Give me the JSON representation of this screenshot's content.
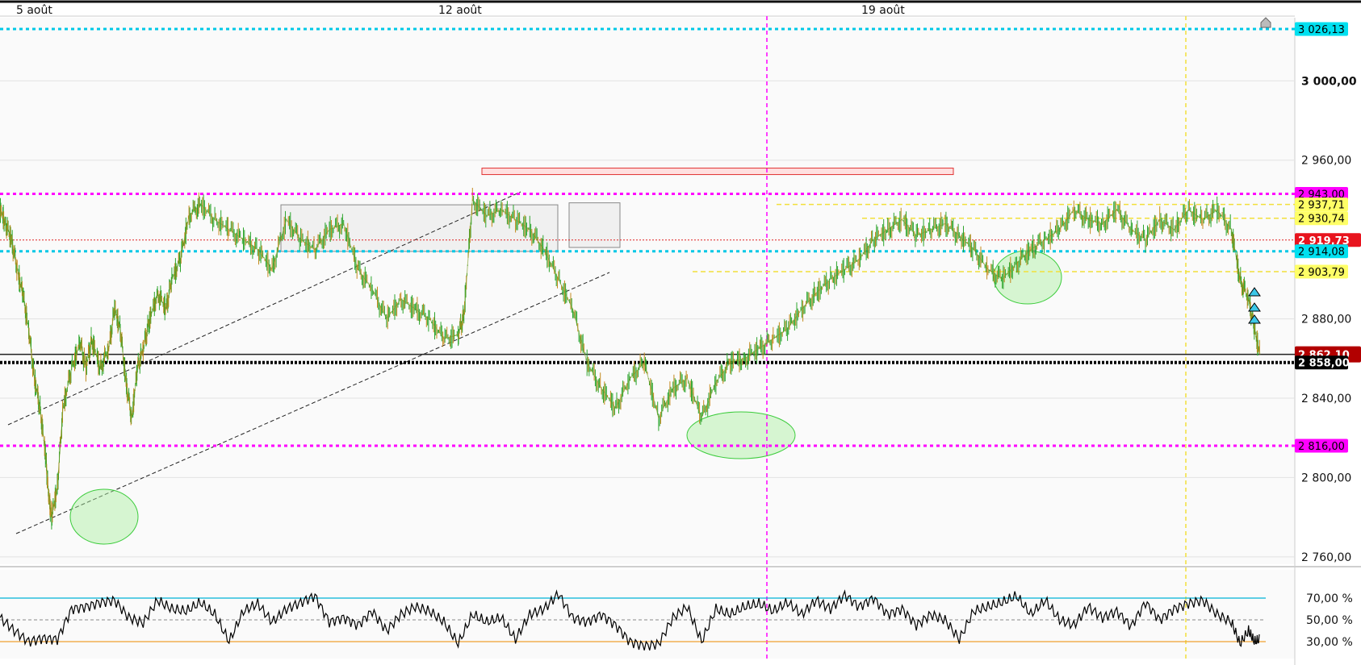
{
  "chart_data": {
    "type": "line",
    "instrument_panel": "price",
    "dates": [
      "5 août",
      "12 août",
      "19 août"
    ],
    "price_axis": {
      "ylim": [
        2752,
        2936.5
      ],
      "ticks": [
        {
          "value": 3000,
          "label": "3 000,00",
          "bold": true
        },
        {
          "value": 2960,
          "label": "2 960,00"
        },
        {
          "value": 2880,
          "label": "2 880,00"
        },
        {
          "value": 2840,
          "label": "2 840,00"
        },
        {
          "value": 2800,
          "label": "2 800,00"
        },
        {
          "value": 2760,
          "label": "2 760,00"
        }
      ]
    },
    "levels": [
      {
        "value": 3026.13,
        "label": "3 026,13",
        "style": "dotted",
        "color": "#00c8e6",
        "tag_bg": "#00e0f0",
        "tag_fg": "#000"
      },
      {
        "value": 2943.0,
        "label": "2 943,00",
        "style": "dotted",
        "color": "#ff00ff",
        "tag_bg": "#ff00ff",
        "tag_fg": "#000"
      },
      {
        "value": 2937.71,
        "label": "2 937,71",
        "style": "dashed",
        "color": "#f2e03a",
        "tag_bg": "#ffff66",
        "tag_fg": "#000"
      },
      {
        "value": 2930.74,
        "label": "2 930,74",
        "style": "dashed",
        "color": "#f2e03a",
        "tag_bg": "#ffff66",
        "tag_fg": "#000"
      },
      {
        "value": 2919.73,
        "label": "2 919,73",
        "style": "thin-dotted",
        "color": "#e02020",
        "tag_bg": "#e8141e",
        "tag_fg": "#fff"
      },
      {
        "value": 2914.08,
        "label": "2 914,08",
        "style": "dotted",
        "color": "#00c8e6",
        "tag_bg": "#00e0f0",
        "tag_fg": "#000"
      },
      {
        "value": 2903.79,
        "label": "2 903,79",
        "style": "dashed",
        "color": "#f2e03a",
        "tag_bg": "#ffff66",
        "tag_fg": "#000"
      },
      {
        "value": 2862.1,
        "label": "2 862,10",
        "style": "solid",
        "color": "#222",
        "tag_bg": "#b20000",
        "tag_fg": "#fff"
      },
      {
        "value": 2858.0,
        "label": "2 858,00",
        "style": "thick-dotted",
        "color": "#000",
        "tag_bg": "#000",
        "tag_fg": "#fff"
      },
      {
        "value": 2816.0,
        "label": "2 816,00",
        "style": "dotted",
        "color": "#ff00ff",
        "tag_bg": "#ff00ff",
        "tag_fg": "#000"
      }
    ],
    "price_series": [
      [
        0,
        2935
      ],
      [
        0.02,
        2928
      ],
      [
        0.04,
        2920
      ],
      [
        0.06,
        2905
      ],
      [
        0.08,
        2892
      ],
      [
        0.1,
        2875
      ],
      [
        0.12,
        2850
      ],
      [
        0.14,
        2835
      ],
      [
        0.16,
        2810
      ],
      [
        0.17,
        2790
      ],
      [
        0.18,
        2780
      ],
      [
        0.2,
        2795
      ],
      [
        0.22,
        2835
      ],
      [
        0.25,
        2855
      ],
      [
        0.28,
        2868
      ],
      [
        0.3,
        2855
      ],
      [
        0.32,
        2870
      ],
      [
        0.35,
        2855
      ],
      [
        0.38,
        2865
      ],
      [
        0.4,
        2885
      ],
      [
        0.42,
        2875
      ],
      [
        0.44,
        2848
      ],
      [
        0.46,
        2830
      ],
      [
        0.48,
        2855
      ],
      [
        0.5,
        2865
      ],
      [
        0.52,
        2878
      ],
      [
        0.55,
        2893
      ],
      [
        0.58,
        2885
      ],
      [
        0.6,
        2900
      ],
      [
        0.63,
        2910
      ],
      [
        0.66,
        2932
      ],
      [
        0.7,
        2938
      ],
      [
        0.75,
        2930
      ],
      [
        0.8,
        2925
      ],
      [
        0.85,
        2920
      ],
      [
        0.9,
        2915
      ],
      [
        0.95,
        2905
      ],
      [
        1.0,
        2930
      ],
      [
        1.05,
        2920
      ],
      [
        1.1,
        2915
      ],
      [
        1.15,
        2925
      ],
      [
        1.2,
        2928
      ],
      [
        1.25,
        2905
      ],
      [
        1.3,
        2895
      ],
      [
        1.35,
        2880
      ],
      [
        1.4,
        2890
      ],
      [
        1.45,
        2885
      ],
      [
        1.5,
        2880
      ],
      [
        1.55,
        2870
      ],
      [
        1.6,
        2872
      ],
      [
        1.62,
        2882
      ],
      [
        1.65,
        2940
      ],
      [
        1.7,
        2932
      ],
      [
        1.75,
        2935
      ],
      [
        1.8,
        2930
      ],
      [
        1.85,
        2925
      ],
      [
        1.9,
        2915
      ],
      [
        1.95,
        2900
      ],
      [
        2.0,
        2885
      ],
      [
        2.05,
        2858
      ],
      [
        2.1,
        2845
      ],
      [
        2.15,
        2835
      ],
      [
        2.2,
        2850
      ],
      [
        2.25,
        2858
      ],
      [
        2.3,
        2830
      ],
      [
        2.35,
        2845
      ],
      [
        2.4,
        2850
      ],
      [
        2.45,
        2830
      ],
      [
        2.5,
        2848
      ],
      [
        2.55,
        2858
      ],
      [
        2.6,
        2860
      ],
      [
        2.65,
        2865
      ],
      [
        2.7,
        2870
      ],
      [
        2.75,
        2875
      ],
      [
        2.8,
        2885
      ],
      [
        2.85,
        2893
      ],
      [
        2.9,
        2900
      ],
      [
        2.95,
        2905
      ],
      [
        3.0,
        2910
      ],
      [
        3.05,
        2920
      ],
      [
        3.1,
        2925
      ],
      [
        3.15,
        2930
      ],
      [
        3.2,
        2922
      ],
      [
        3.25,
        2925
      ],
      [
        3.3,
        2928
      ],
      [
        3.35,
        2922
      ],
      [
        3.4,
        2915
      ],
      [
        3.45,
        2905
      ],
      [
        3.5,
        2900
      ],
      [
        3.55,
        2908
      ],
      [
        3.6,
        2915
      ],
      [
        3.65,
        2920
      ],
      [
        3.7,
        2925
      ],
      [
        3.75,
        2935
      ],
      [
        3.8,
        2930
      ],
      [
        3.85,
        2928
      ],
      [
        3.9,
        2935
      ],
      [
        3.95,
        2925
      ],
      [
        4.0,
        2920
      ],
      [
        4.05,
        2930
      ],
      [
        4.1,
        2925
      ],
      [
        4.15,
        2935
      ],
      [
        4.2,
        2930
      ],
      [
        4.25,
        2935
      ],
      [
        4.3,
        2925
      ],
      [
        4.33,
        2900
      ],
      [
        4.36,
        2890
      ],
      [
        4.38,
        2875
      ],
      [
        4.4,
        2862
      ]
    ],
    "rsi": {
      "axis_ticks": [
        {
          "value": 70,
          "label": "70,00 %"
        },
        {
          "value": 50,
          "label": "50,00 %"
        },
        {
          "value": 30,
          "label": "30,00 %"
        }
      ],
      "series": [
        [
          0,
          52
        ],
        [
          0.05,
          40
        ],
        [
          0.1,
          30
        ],
        [
          0.15,
          33
        ],
        [
          0.2,
          32
        ],
        [
          0.25,
          60
        ],
        [
          0.3,
          62
        ],
        [
          0.35,
          66
        ],
        [
          0.4,
          68
        ],
        [
          0.45,
          52
        ],
        [
          0.5,
          47
        ],
        [
          0.55,
          68
        ],
        [
          0.6,
          60
        ],
        [
          0.65,
          58
        ],
        [
          0.7,
          66
        ],
        [
          0.75,
          55
        ],
        [
          0.8,
          30
        ],
        [
          0.85,
          58
        ],
        [
          0.9,
          65
        ],
        [
          0.95,
          48
        ],
        [
          1.0,
          60
        ],
        [
          1.05,
          66
        ],
        [
          1.1,
          72
        ],
        [
          1.15,
          48
        ],
        [
          1.2,
          52
        ],
        [
          1.25,
          45
        ],
        [
          1.3,
          58
        ],
        [
          1.35,
          40
        ],
        [
          1.4,
          55
        ],
        [
          1.45,
          62
        ],
        [
          1.5,
          58
        ],
        [
          1.55,
          48
        ],
        [
          1.6,
          28
        ],
        [
          1.65,
          55
        ],
        [
          1.7,
          48
        ],
        [
          1.75,
          52
        ],
        [
          1.8,
          32
        ],
        [
          1.85,
          55
        ],
        [
          1.9,
          60
        ],
        [
          1.95,
          74
        ],
        [
          2.0,
          52
        ],
        [
          2.05,
          48
        ],
        [
          2.1,
          55
        ],
        [
          2.15,
          45
        ],
        [
          2.2,
          30
        ],
        [
          2.25,
          26
        ],
        [
          2.3,
          28
        ],
        [
          2.35,
          52
        ],
        [
          2.4,
          62
        ],
        [
          2.45,
          30
        ],
        [
          2.5,
          60
        ],
        [
          2.55,
          55
        ],
        [
          2.6,
          62
        ],
        [
          2.65,
          65
        ],
        [
          2.7,
          58
        ],
        [
          2.75,
          66
        ],
        [
          2.8,
          55
        ],
        [
          2.85,
          68
        ],
        [
          2.9,
          60
        ],
        [
          2.95,
          73
        ],
        [
          3.0,
          62
        ],
        [
          3.05,
          70
        ],
        [
          3.1,
          55
        ],
        [
          3.15,
          60
        ],
        [
          3.2,
          45
        ],
        [
          3.25,
          55
        ],
        [
          3.3,
          50
        ],
        [
          3.35,
          32
        ],
        [
          3.4,
          58
        ],
        [
          3.45,
          62
        ],
        [
          3.5,
          66
        ],
        [
          3.55,
          72
        ],
        [
          3.6,
          55
        ],
        [
          3.65,
          68
        ],
        [
          3.7,
          50
        ],
        [
          3.75,
          45
        ],
        [
          3.8,
          62
        ],
        [
          3.85,
          52
        ],
        [
          3.9,
          58
        ],
        [
          3.95,
          44
        ],
        [
          4.0,
          66
        ],
        [
          4.05,
          50
        ],
        [
          4.1,
          60
        ],
        [
          4.15,
          65
        ],
        [
          4.2,
          68
        ],
        [
          4.25,
          55
        ],
        [
          4.3,
          48
        ],
        [
          4.33,
          28
        ],
        [
          4.36,
          40
        ],
        [
          4.38,
          30
        ],
        [
          4.4,
          32
        ]
      ],
      "overbought": 70,
      "oversold": 30,
      "mid": 50
    }
  },
  "colors": {
    "price_up": "#2da52d",
    "price_down": "#c48a1e",
    "rsi_line": "#000000",
    "rsi_overbought": "#00b4d8",
    "rsi_oversold": "#f0a030",
    "fill_zone": "#f0f0f0",
    "resistance_zone": "#ffe0e0",
    "ellipse": "#aaf0a0",
    "vline": "#ff00ff",
    "vline_yellow": "#f2e03a"
  },
  "icons": [
    "home-icon",
    "triangle-up-marker-icon"
  ]
}
